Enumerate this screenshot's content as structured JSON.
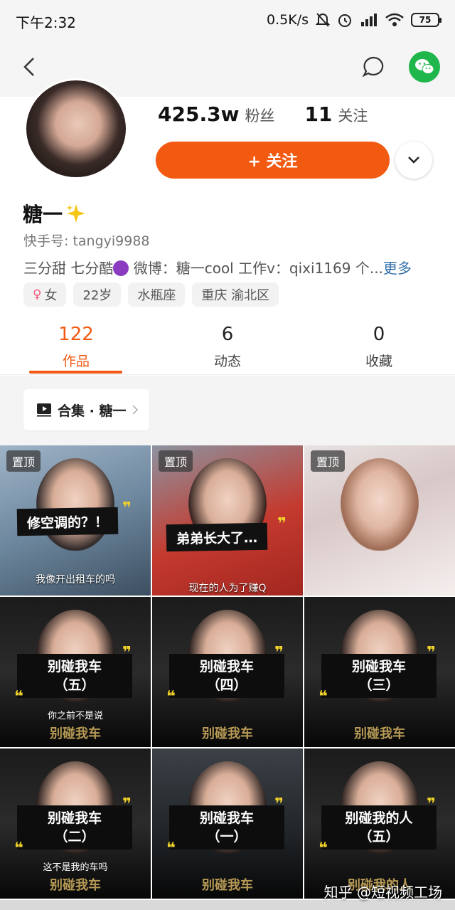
{
  "status_bar": {
    "time": "下午2:32",
    "speed": "0.5K/s",
    "battery": "75",
    "icons": [
      "mute-icon",
      "alarm-icon",
      "signal-icon",
      "wifi-icon",
      "battery-icon"
    ]
  },
  "nav": {
    "back_icon": "chevron-left-icon",
    "chat_icon": "chat-bubble-icon",
    "share_icon": "wechat-icon"
  },
  "profile": {
    "followers_count": "425.3w",
    "followers_label": "粉丝",
    "following_count": "11",
    "following_label": "关注",
    "follow_button": "+ 关注",
    "name": "糖一",
    "kuaishou_id": "快手号: tangyi9988",
    "bio": "三分甜 七分酷",
    "bio_rest": " 微博：糖一cool 工作v：qixi1169 个...",
    "bio_more": "更多",
    "tags": [
      "女",
      "22岁",
      "水瓶座",
      "重庆 渝北区"
    ]
  },
  "tabs": [
    {
      "count": "122",
      "label": "作品"
    },
    {
      "count": "6",
      "label": "动态"
    },
    {
      "count": "0",
      "label": "收藏"
    }
  ],
  "collection": {
    "label": "合集 · 糖一"
  },
  "videos": [
    {
      "pin": "置顶",
      "caption": "修空调的？！",
      "subtitle": "我像开出租车的吗"
    },
    {
      "pin": "置顶",
      "caption": "弟弟长大了…",
      "subtitle": "现在的人为了赚Q"
    },
    {
      "pin": "置顶"
    },
    {
      "series_title": "别碰我车",
      "series_num": "（五）",
      "subtitle": "你之前不是说",
      "footer": "别碰我车"
    },
    {
      "series_title": "别碰我车",
      "series_num": "（四）",
      "footer": "别碰我车"
    },
    {
      "series_title": "别碰我车",
      "series_num": "（三）",
      "footer": "别碰我车"
    },
    {
      "series_title": "别碰我车",
      "series_num": "（二）",
      "subtitle": "这不是我的车吗",
      "footer": "别碰我车"
    },
    {
      "series_title": "别碰我车",
      "series_num": "（一）",
      "footer": "别碰我车"
    },
    {
      "series_title": "别碰我的人",
      "series_num": "（五）",
      "footer": "别碰我的人"
    }
  ],
  "watermark": "知乎 @短视频工场",
  "colors": {
    "accent": "#f25a12",
    "wechat": "#1fb64b",
    "link": "#2f6ea8"
  }
}
